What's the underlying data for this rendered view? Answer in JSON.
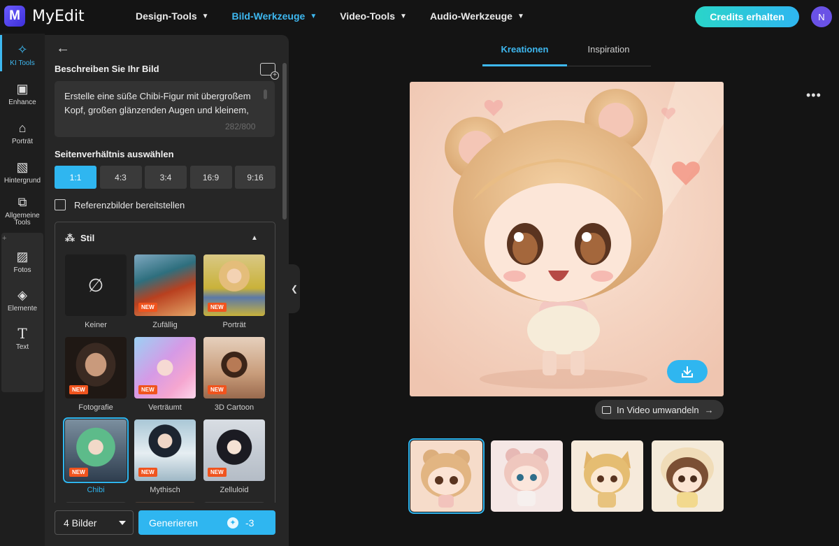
{
  "app": {
    "logo_letter": "M",
    "name": "MyEdit"
  },
  "nav": [
    {
      "label": "Design-Tools"
    },
    {
      "label": "Bild-Werkzeuge"
    },
    {
      "label": "Video-Tools"
    },
    {
      "label": "Audio-Werkzeuge"
    }
  ],
  "header": {
    "credits_label": "Credits erhalten",
    "avatar_initial": "N"
  },
  "rail": [
    {
      "label": "KI Tools",
      "icon": "magic-wand-icon"
    },
    {
      "label": "Enhance",
      "icon": "enhance-icon"
    },
    {
      "label": "Porträt",
      "icon": "portrait-icon"
    },
    {
      "label": "Hintergrund",
      "icon": "background-icon"
    },
    {
      "label": "Allgemeine Tools",
      "icon": "general-tools-icon"
    },
    {
      "label": "Fotos",
      "icon": "photos-icon"
    },
    {
      "label": "Elemente",
      "icon": "elements-icon"
    },
    {
      "label": "Text",
      "icon": "text-icon"
    }
  ],
  "panel": {
    "describe_title": "Beschreiben Sie Ihr Bild",
    "prompt_text": "Erstelle eine süße Chibi-Figur mit übergroßem Kopf, großen glänzenden Augen und kleinem,",
    "prompt_count": "282/800",
    "ratio_title": "Seitenverhältnis auswählen",
    "ratios": [
      "1:1",
      "4:3",
      "3:4",
      "16:9",
      "9:16"
    ],
    "selected_ratio": "1:1",
    "reference_label": "Referenzbilder bereitstellen",
    "style_title": "Stil",
    "styles": [
      {
        "label": "Keiner",
        "new": false
      },
      {
        "label": "Zufällig",
        "new": true
      },
      {
        "label": "Porträt",
        "new": true
      },
      {
        "label": "Fotografie",
        "new": true
      },
      {
        "label": "Verträumt",
        "new": true
      },
      {
        "label": "3D Cartoon",
        "new": true
      },
      {
        "label": "Chibi",
        "new": true
      },
      {
        "label": "Mythisch",
        "new": true
      },
      {
        "label": "Zelluloid",
        "new": true
      }
    ],
    "new_badge": "NEW",
    "selected_style": "Chibi",
    "image_count": "4 Bilder",
    "generate_label": "Generieren",
    "generate_cost": "-3"
  },
  "main": {
    "tabs": [
      "Kreationen",
      "Inspiration"
    ],
    "active_tab": "Kreationen",
    "video_button_label": "In Video umwandeln",
    "thumbnails": 4,
    "selected_thumbnail": 0
  },
  "colors": {
    "accent": "#2fb6f0",
    "badge": "#f0541e",
    "panel": "#262626",
    "background": "#141414"
  }
}
